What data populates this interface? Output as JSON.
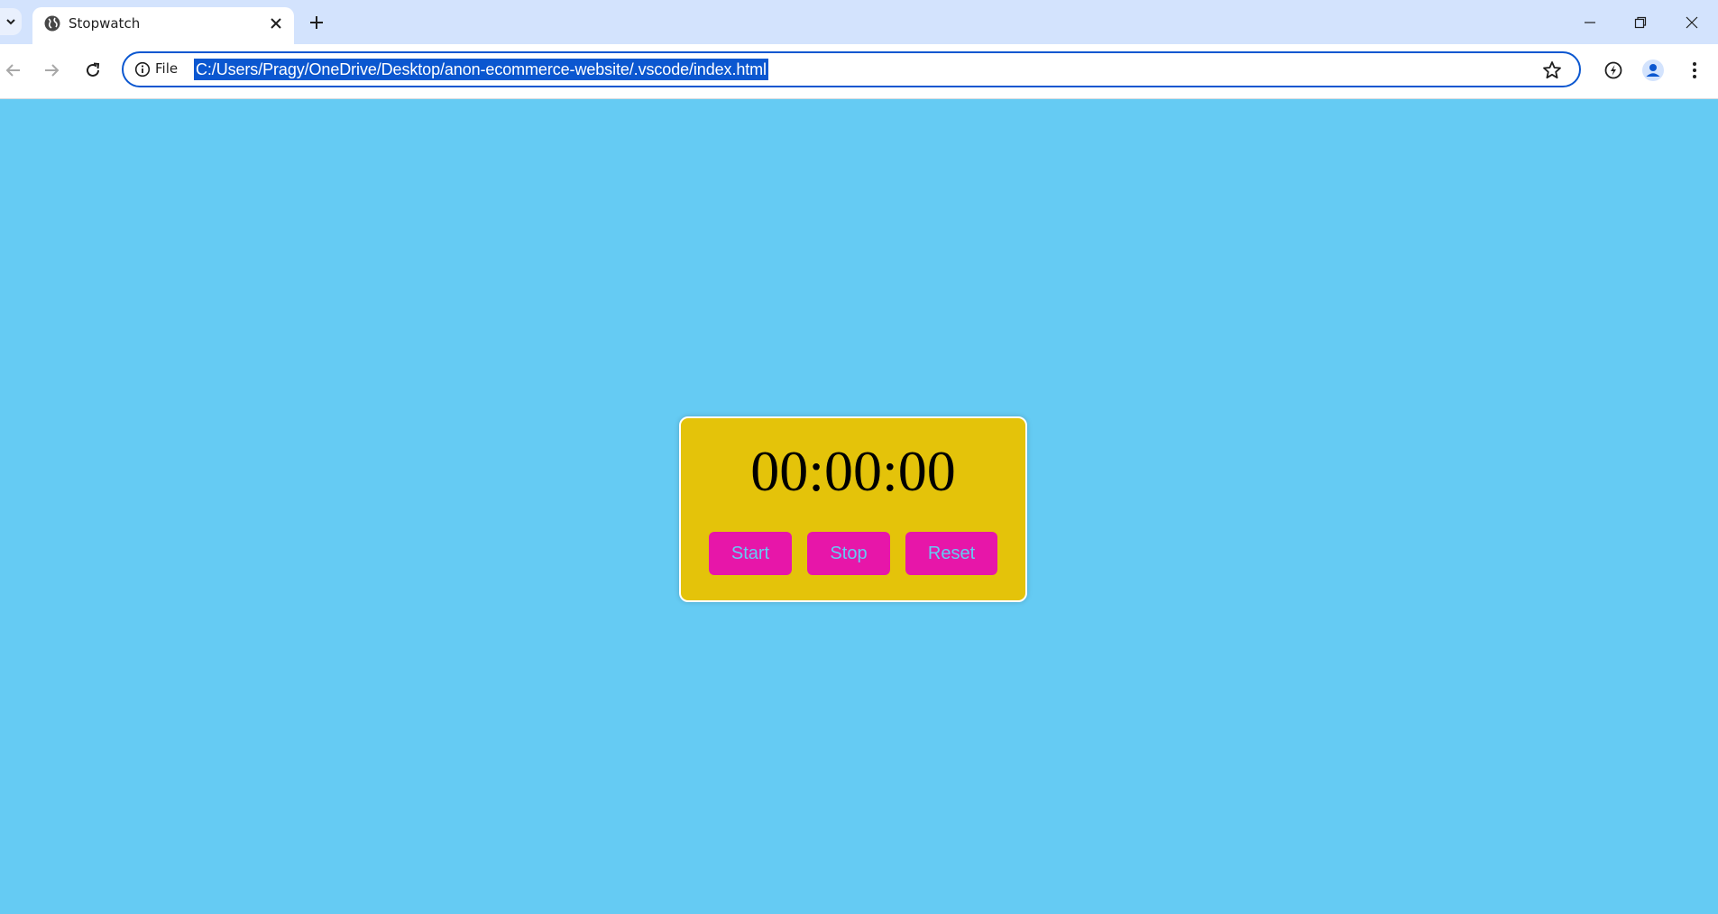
{
  "browser": {
    "tab": {
      "title": "Stopwatch",
      "favicon": "globe-icon",
      "close_icon": "close-icon"
    },
    "new_tab_icon": "plus-icon",
    "window_controls": [
      "minimize-icon",
      "restore-icon",
      "close-icon"
    ],
    "toolbar": {
      "back_icon": "arrow-left-icon",
      "forward_icon": "arrow-right-icon",
      "reload_icon": "reload-icon",
      "site_info_label": "File",
      "url": "C:/Users/Pragy/OneDrive/Desktop/anon-ecommerce-website/.vscode/index.html",
      "bookmark_icon": "star-icon",
      "right_icons": [
        "performance-icon",
        "profile-icon",
        "menu-icon"
      ]
    }
  },
  "page": {
    "background": "#65cbf3",
    "stopwatch": {
      "time": "00:00:00",
      "card_color": "#e4c30a",
      "button_color": "#e716a9",
      "button_text_color": "#65cbf3",
      "buttons": {
        "start": "Start",
        "stop": "Stop",
        "reset": "Reset"
      }
    }
  }
}
